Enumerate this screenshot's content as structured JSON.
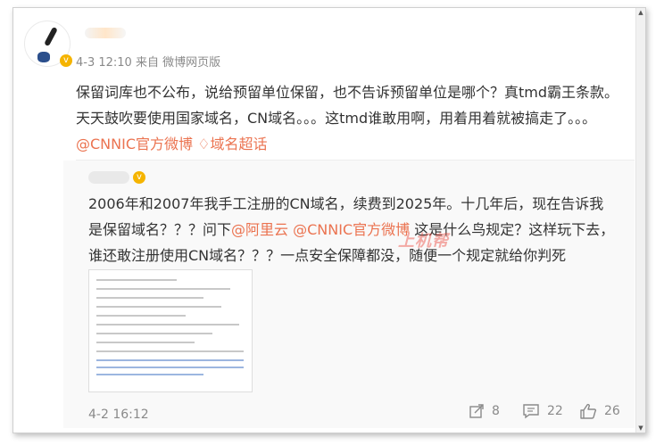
{
  "post": {
    "meta": "4-3 12:10 来自 微博网页版",
    "text_before": "保留词库也不公布，说给预留单位保留，也不告诉预留单位是哪个？真tmd霸王条款。天天鼓吹要使用国家域名，CN域名。。。这tmd谁敢用啊，用着用着就被搞走了。。。",
    "mention": "@CNNIC官方微博",
    "topic": "域名超话"
  },
  "repost": {
    "text_before": "2006年和2007年我手工注册的CN域名，续费到2025年。十几年后，现在告诉我是保留域名？？？问下",
    "mention1": "@阿里云",
    "mention2": "@CNNIC官方微博",
    "text_after": " 这是什么鸟规定？这样玩下去，谁还敢注册使用CN域名？？？一点安全保障都没，随便一个规定就给你判死刑？？？",
    "watermark": "上机帮",
    "date": "4-2 16:12",
    "actions": {
      "share_count": "8",
      "comment_count": "22",
      "like_count": "26"
    }
  },
  "colors": {
    "link": "#eb7350",
    "meta_text": "#8a8a8a",
    "body_text": "#333333",
    "repost_bg": "#f9f9f9",
    "verify_badge": "#f5b400"
  },
  "icons": [
    "verified-badge-icon",
    "topic-diamond-icon",
    "share-icon",
    "comment-icon",
    "like-icon"
  ]
}
